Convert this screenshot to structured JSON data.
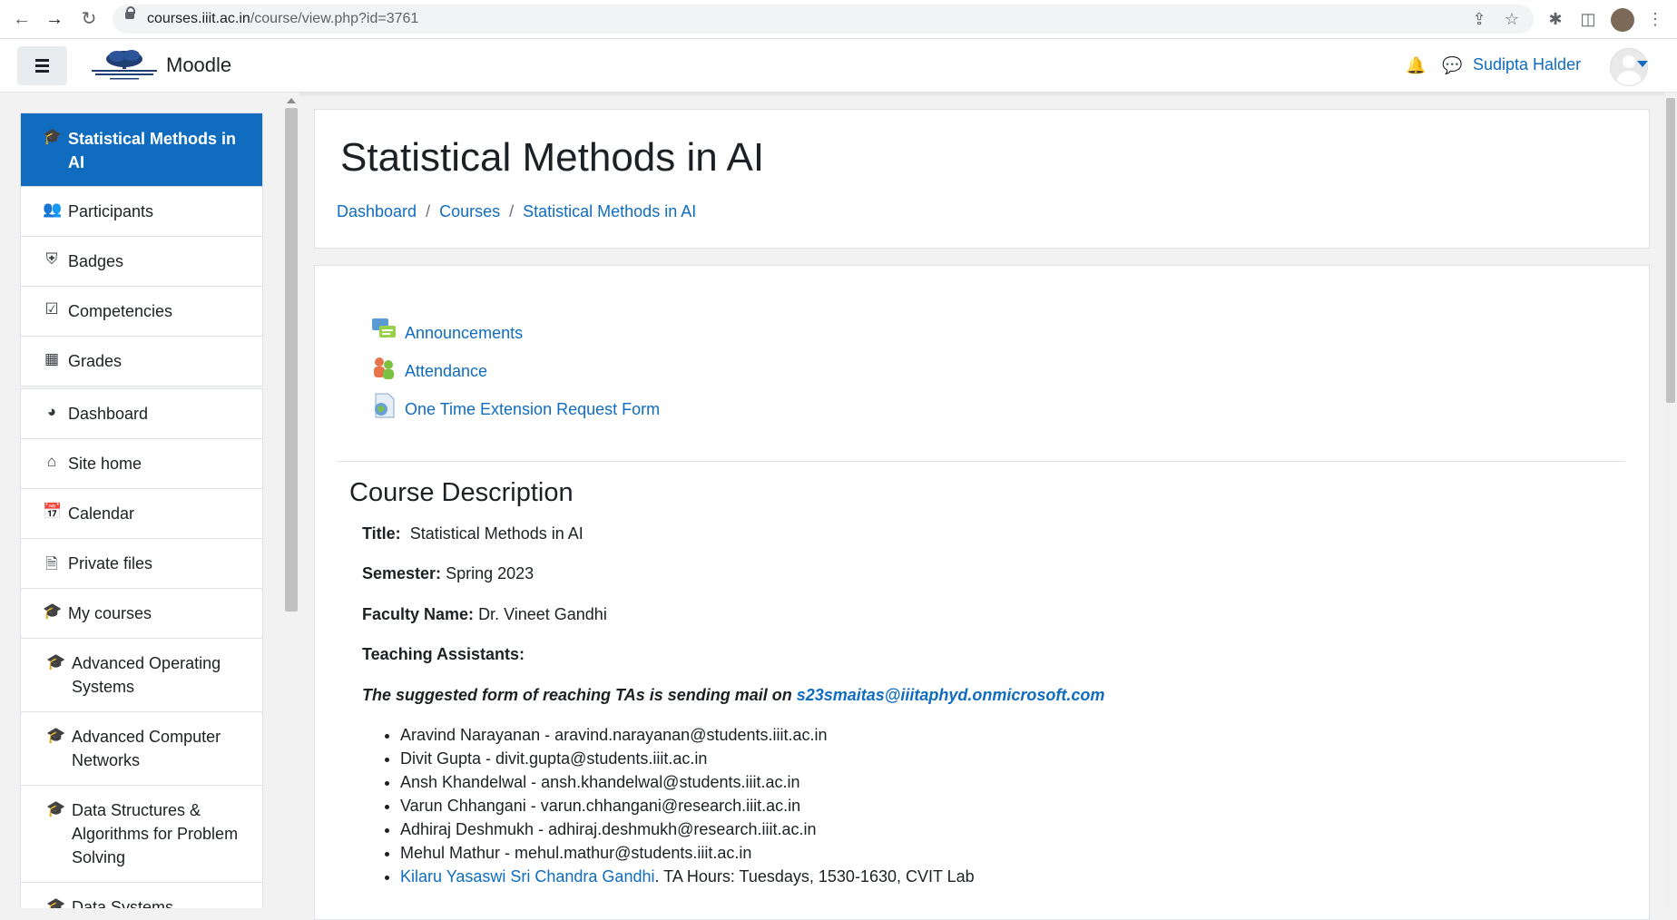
{
  "browser": {
    "url_host": "courses.iiit.ac.in",
    "url_path": "/course/view.php?id=3761"
  },
  "navbar": {
    "brand": "Moodle",
    "user_name": "Sudipta Halder"
  },
  "sidebar": {
    "course_items": [
      {
        "label": "Statistical Methods in AI",
        "icon": "graduation-cap-icon"
      },
      {
        "label": "Participants",
        "icon": "users-icon"
      },
      {
        "label": "Badges",
        "icon": "shield-icon"
      },
      {
        "label": "Competencies",
        "icon": "check-square-icon"
      },
      {
        "label": "Grades",
        "icon": "table-icon"
      }
    ],
    "site_items": [
      {
        "label": "Dashboard",
        "icon": "dashboard-icon"
      },
      {
        "label": "Site home",
        "icon": "home-icon"
      },
      {
        "label": "Calendar",
        "icon": "calendar-icon"
      },
      {
        "label": "Private files",
        "icon": "file-icon"
      },
      {
        "label": "My courses",
        "icon": "graduation-cap-icon"
      },
      {
        "label": "Advanced Operating Systems",
        "icon": "graduation-cap-icon"
      },
      {
        "label": "Advanced Computer Networks",
        "icon": "graduation-cap-icon"
      },
      {
        "label": "Data Structures & Algorithms for Problem Solving",
        "icon": "graduation-cap-icon"
      },
      {
        "label": "Data Systems",
        "icon": "graduation-cap-icon"
      }
    ]
  },
  "header": {
    "title": "Statistical Methods in AI",
    "breadcrumb": [
      "Dashboard",
      "Courses",
      "Statistical Methods in AI"
    ],
    "separator": "/"
  },
  "activities": [
    {
      "label": "Announcements",
      "icon": "forum-icon"
    },
    {
      "label": "Attendance",
      "icon": "attendance-icon"
    },
    {
      "label": "One Time Extension Request Form",
      "icon": "form-icon"
    }
  ],
  "description": {
    "heading": "Course Description",
    "title_label": "Title:",
    "title_value": "Statistical Methods in AI",
    "semester_label": "Semester:",
    "semester_value": "Spring 2023",
    "faculty_label": "Faculty Name:",
    "faculty_value": "Dr. Vineet Gandhi",
    "ta_heading": "Teaching Assistants:",
    "note_text": "The suggested form of reaching TAs is sending mail on ",
    "note_email": "s23smaitas@iiitaphyd.onmicrosoft.com",
    "tas": [
      "Aravind Narayanan - aravind.narayanan@students.iiit.ac.in",
      "Divit Gupta - divit.gupta@students.iiit.ac.in",
      "Ansh Khandelwal - ansh.khandelwal@students.iiit.ac.in",
      "Varun Chhangani - varun.chhangani@research.iiit.ac.in",
      "Adhiraj Deshmukh - adhiraj.deshmukh@research.iiit.ac.in",
      "Mehul Mathur - mehul.mathur@students.iiit.ac.in"
    ],
    "last_ta_link": "Kilaru Yasaswi Sri Chandra Gandhi",
    "last_ta_text": ". TA Hours: Tuesdays, 1530-1630, CVIT Lab"
  }
}
